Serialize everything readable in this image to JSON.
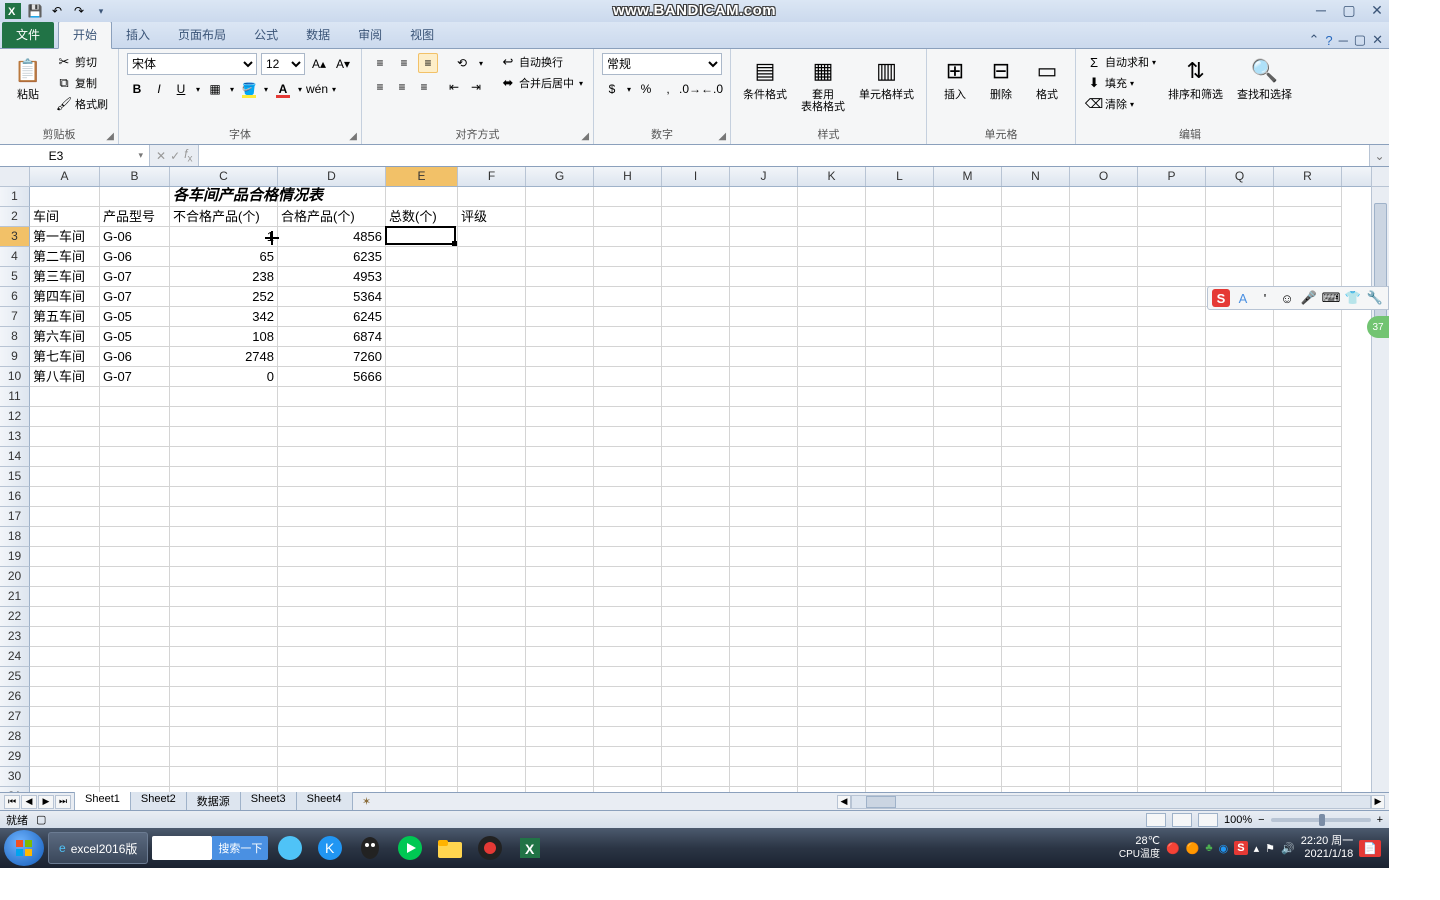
{
  "titlebar": {
    "watermark": "www.BANDICAM.com"
  },
  "tabs": {
    "file": "文件",
    "items": [
      "开始",
      "插入",
      "页面布局",
      "公式",
      "数据",
      "审阅",
      "视图"
    ],
    "activeIndex": 0
  },
  "ribbon": {
    "clipboard": {
      "paste": "粘贴",
      "cut": "剪切",
      "copy": "复制",
      "formatPainter": "格式刷",
      "label": "剪贴板"
    },
    "font": {
      "name": "宋体",
      "size": "12",
      "label": "字体"
    },
    "alignment": {
      "wrap": "自动换行",
      "merge": "合并后居中",
      "label": "对齐方式"
    },
    "number": {
      "format": "常规",
      "label": "数字"
    },
    "styles": {
      "conditional": "条件格式",
      "tableFmt": "套用\n表格格式",
      "cellStyle": "单元格样式",
      "label": "样式"
    },
    "cells": {
      "insert": "插入",
      "delete": "删除",
      "format": "格式",
      "label": "单元格"
    },
    "editing": {
      "autosum": "自动求和",
      "fill": "填充",
      "clear": "清除",
      "sort": "排序和筛选",
      "find": "查找和选择",
      "label": "编辑"
    }
  },
  "formula": {
    "nameBox": "E3",
    "value": ""
  },
  "grid": {
    "cols": [
      "A",
      "B",
      "C",
      "D",
      "E",
      "F",
      "G",
      "H",
      "I",
      "J",
      "K",
      "L",
      "M",
      "N",
      "O",
      "P",
      "Q",
      "R"
    ],
    "rowCount": 31,
    "title": "各车间产品合格情况表",
    "headers": [
      "车间",
      "产品型号",
      "不合格产品(个)",
      "合格产品(个)",
      "总数(个)",
      "评级"
    ],
    "rows": [
      [
        "第一车间",
        "G-06",
        "1",
        "4856"
      ],
      [
        "第二车间",
        "G-06",
        "65",
        "6235"
      ],
      [
        "第三车间",
        "G-07",
        "238",
        "4953"
      ],
      [
        "第四车间",
        "G-07",
        "252",
        "5364"
      ],
      [
        "第五车间",
        "G-05",
        "342",
        "6245"
      ],
      [
        "第六车间",
        "G-05",
        "108",
        "6874"
      ],
      [
        "第七车间",
        "G-06",
        "2748",
        "7260"
      ],
      [
        "第八车间",
        "G-07",
        "0",
        "5666"
      ]
    ],
    "activeCell": "E3",
    "activeCol": 4,
    "activeRow": 2
  },
  "sheets": {
    "tabs": [
      "Sheet1",
      "Sheet2",
      "数据源",
      "Sheet3",
      "Sheet4"
    ],
    "activeIndex": 0
  },
  "status": {
    "ready": "就绪",
    "zoom": "100%"
  },
  "taskbar": {
    "app1": "excel2016版",
    "searchPlaceholder": "",
    "searchBtn": "搜索一下",
    "temp": "28℃",
    "tempLabel": "CPU温度",
    "time": "22:20 周一",
    "date": "2021/1/18"
  }
}
